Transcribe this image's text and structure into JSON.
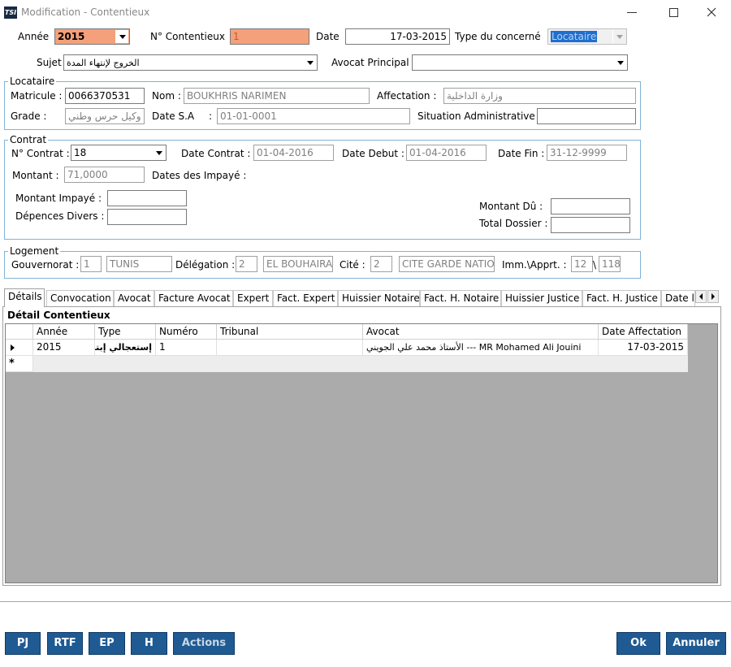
{
  "window": {
    "title": "Modification - Contentieux",
    "app_badge": "TSI"
  },
  "header": {
    "annee_label": "Année",
    "annee_value": "2015",
    "no_contentieux_label": "N° Contentieux",
    "no_contentieux_value": "1",
    "date_label": "Date",
    "date_value": "17-03-2015",
    "type_concerne_label": "Type du concerné",
    "type_concerne_value": "Locataire",
    "sujet_label": "Sujet",
    "sujet_value": "الخروج لإنتهاء المدة",
    "avocat_principal_label": "Avocat Principal",
    "avocat_principal_value": ""
  },
  "locataire": {
    "legend": "Locataire",
    "matricule_label": "Matricule :",
    "matricule_value": "0066370531",
    "nom_label": "Nom :",
    "nom_value": "BOUKHRIS NARIMEN",
    "affectation_label": "Affectation :",
    "affectation_value": "وزارة الداخلية",
    "grade_label": "Grade :",
    "grade_value": "وكيل حرس وطني",
    "date_sa_label": "Date S.A",
    "date_sa_colon": ":",
    "date_sa_value": "01-01-0001",
    "situation_label": "Situation Administrative :",
    "situation_value": ""
  },
  "contrat": {
    "legend": "Contrat",
    "no_contrat_label": "N° Contrat :",
    "no_contrat_value": "18",
    "date_contrat_label": "Date Contrat :",
    "date_contrat_value": "01-04-2016",
    "date_debut_label": "Date Debut :",
    "date_debut_value": "01-04-2016",
    "date_fin_label": "Date Fin :",
    "date_fin_value": "31-12-9999",
    "montant_label": "Montant :",
    "montant_value": "71,0000",
    "dates_impaye_label": "Dates des Impayé :",
    "montant_impaye_label": "Montant Impayé :",
    "montant_impaye_value": "",
    "depences_label": "Dépences Divers :",
    "depences_value": "",
    "montant_du_label": "Montant Dû :",
    "montant_du_value": "",
    "total_dossier_label": "Total Dossier :",
    "total_dossier_value": ""
  },
  "logement": {
    "legend": "Logement",
    "gouvernorat_label": "Gouvernorat :",
    "gouvernorat_code": "1",
    "gouvernorat_name": "TUNIS",
    "delegation_label": "Délégation :",
    "delegation_code": "2",
    "delegation_name": "EL BOUHAIRA",
    "cite_label": "Cité :",
    "cite_code": "2",
    "cite_name": "CITE GARDE NATIO",
    "imm_label": "Imm.\\Apprt. :",
    "imm_value": "12",
    "separator": "\\",
    "apprt_value": "118"
  },
  "tabs": [
    "Détails",
    "Convocation",
    "Avocat",
    "Facture Avocat",
    "Expert",
    "Fact. Expert",
    "Huissier Notaire",
    "Fact. H. Notaire",
    "Huissier Justice",
    "Fact. H. Justice",
    "Date l"
  ],
  "grid": {
    "title": "Détail Contentieux",
    "columns": [
      "Année",
      "Type",
      "Numéro",
      "Tribunal",
      "Avocat",
      "Date Affectation"
    ],
    "rows": [
      [
        "2015",
        "إستعجالي إبتدائي",
        "1",
        "",
        "الأستاذ محمد علي الجويني --- MR Mohamed Ali Jouini",
        "17-03-2015"
      ]
    ],
    "new_row_marker": "*"
  },
  "buttons": {
    "pj": "PJ",
    "rtf": "RTF",
    "ep": "EP",
    "h": "H",
    "actions": "Actions",
    "ok": "Ok",
    "annuler": "Annuler"
  },
  "colors": {
    "highlight_field": "#f4a07a",
    "group_border": "#7fb3d8",
    "button_bg": "#1f5a93"
  }
}
